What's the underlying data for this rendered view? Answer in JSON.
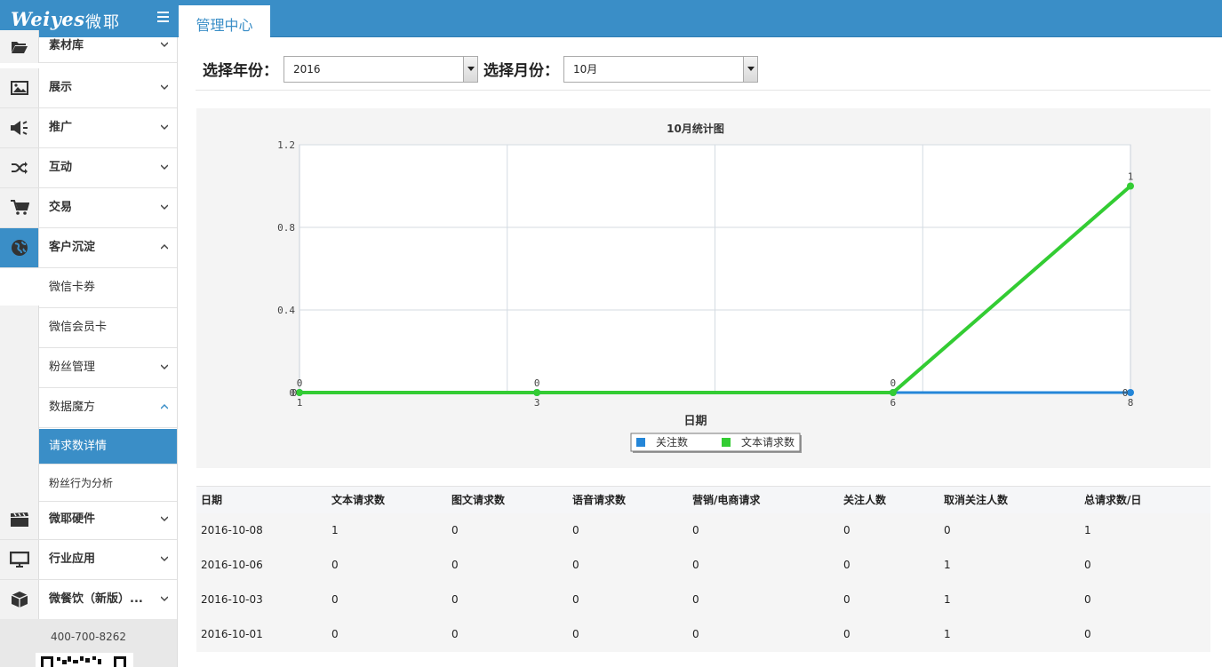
{
  "header": {
    "logo_brand": "Weiyes",
    "logo_cn": "微耶",
    "tab_main": "管理中心"
  },
  "sidebar": {
    "items": [
      {
        "label": "素材库",
        "icon": "folder-open-icon"
      },
      {
        "label": "展示",
        "icon": "picture-icon"
      },
      {
        "label": "推广",
        "icon": "megaphone-icon"
      },
      {
        "label": "互动",
        "icon": "shuffle-icon"
      },
      {
        "label": "交易",
        "icon": "cart-icon"
      },
      {
        "label": "客户沉淀",
        "icon": "globe-icon",
        "expanded": true
      },
      {
        "label": "微耶硬件",
        "icon": "clapper-icon"
      },
      {
        "label": "行业应用",
        "icon": "monitor-icon"
      },
      {
        "label": "微餐饮（新版）...",
        "icon": "cube-icon"
      }
    ],
    "sub_items": [
      {
        "label": "微信卡券"
      },
      {
        "label": "微信会员卡"
      },
      {
        "label": "粉丝管理"
      },
      {
        "label": "数据魔方"
      },
      {
        "label": "请求数详情",
        "selected": true
      },
      {
        "label": "粉丝行为分析"
      }
    ],
    "phone": "400-700-8262"
  },
  "filter": {
    "year_label": "选择年份：",
    "year_value": "2016",
    "month_label": "选择月份：",
    "month_value": "10月"
  },
  "chart_data": {
    "type": "line",
    "title": "10月统计图",
    "xlabel": "日期",
    "ylabel": "",
    "x": [
      1,
      3,
      6,
      8
    ],
    "xlim": [
      1,
      8
    ],
    "ylim": [
      0,
      1.2
    ],
    "yticks": [
      "0",
      "0.4",
      "0.8",
      "1.2"
    ],
    "grid": true,
    "legend_position": "bottom-center",
    "series": [
      {
        "name": "关注数",
        "values": [
          0,
          0,
          0,
          0
        ],
        "color": "#2486d8"
      },
      {
        "name": "文本请求数",
        "values": [
          0,
          0,
          0,
          1
        ],
        "color": "#33cc33"
      }
    ],
    "point_labels": [
      "0",
      "0",
      "0",
      "1"
    ],
    "point_labels_bottom": [
      "0",
      "",
      "",
      "0"
    ]
  },
  "table": {
    "headers": [
      "日期",
      "文本请求数",
      "图文请求数",
      "语音请求数",
      "营销/电商请求",
      "关注人数",
      "取消关注人数",
      "总请求数/日"
    ],
    "rows": [
      [
        "2016-10-08",
        "1",
        "0",
        "0",
        "0",
        "0",
        "0",
        "1"
      ],
      [
        "2016-10-06",
        "0",
        "0",
        "0",
        "0",
        "0",
        "1",
        "0"
      ],
      [
        "2016-10-03",
        "0",
        "0",
        "0",
        "0",
        "0",
        "1",
        "0"
      ],
      [
        "2016-10-01",
        "0",
        "0",
        "0",
        "0",
        "0",
        "1",
        "0"
      ]
    ]
  }
}
